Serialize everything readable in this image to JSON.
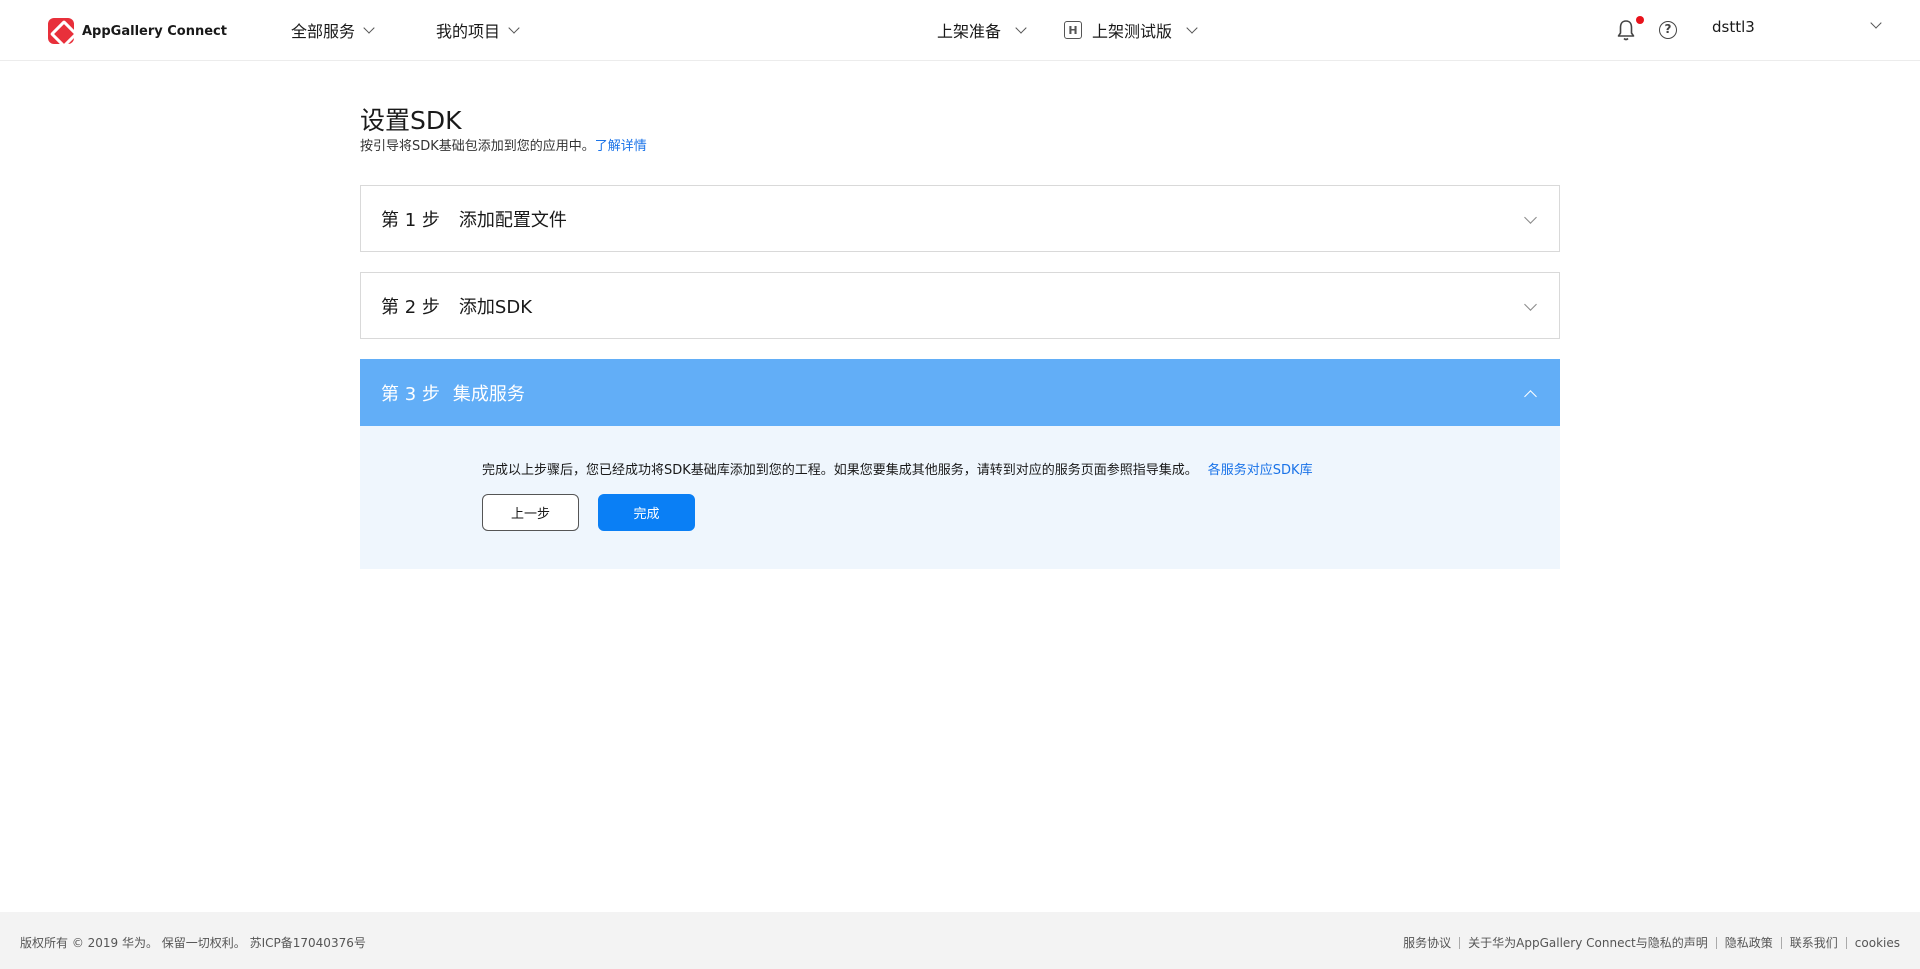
{
  "header": {
    "brand_name": "AppGallery Connect",
    "nav": {
      "all_services": "全部服务",
      "my_projects": "我的项目",
      "release_prep": "上架准备",
      "test_badge": "H",
      "test_version": "上架测试版"
    },
    "help_symbol": "?",
    "username": "dsttl3",
    "icons": [
      "brand-logo",
      "bell-icon",
      "help-icon",
      "chevron-down-icon"
    ]
  },
  "main": {
    "title": "设置SDK",
    "subtitle": "按引导将SDK基础包添加到您的应用中。",
    "learn_more": "了解详情",
    "steps": [
      {
        "no": "第 1 步",
        "title": "添加配置文件",
        "expanded": false
      },
      {
        "no": "第 2 步",
        "title": "添加SDK",
        "expanded": false
      },
      {
        "no": "第 3 步",
        "title": "集成服务",
        "expanded": true
      }
    ],
    "panel": {
      "text": "完成以上步骤后，您已经成功将SDK基础库添加到您的工程。如果您要集成其他服务，请转到对应的服务页面参照指导集成。",
      "link": "各服务对应SDK库",
      "prev_button": "上一步",
      "done_button": "完成"
    }
  },
  "footer": {
    "copyright": "版权所有 © 2019 华为。 保留一切权利。 苏ICP备17040376号",
    "links": [
      "服务协议",
      "关于华为AppGallery Connect与隐私的声明",
      "隐私政策",
      "联系我们",
      "cookies"
    ]
  },
  "colors": {
    "brand": "#e8303b",
    "active_step": "#62aef7",
    "panel_bg": "#eff6fd",
    "primary_button": "#0a7ff5",
    "link": "#1a73e8",
    "notification_dot": "#e8121b"
  }
}
